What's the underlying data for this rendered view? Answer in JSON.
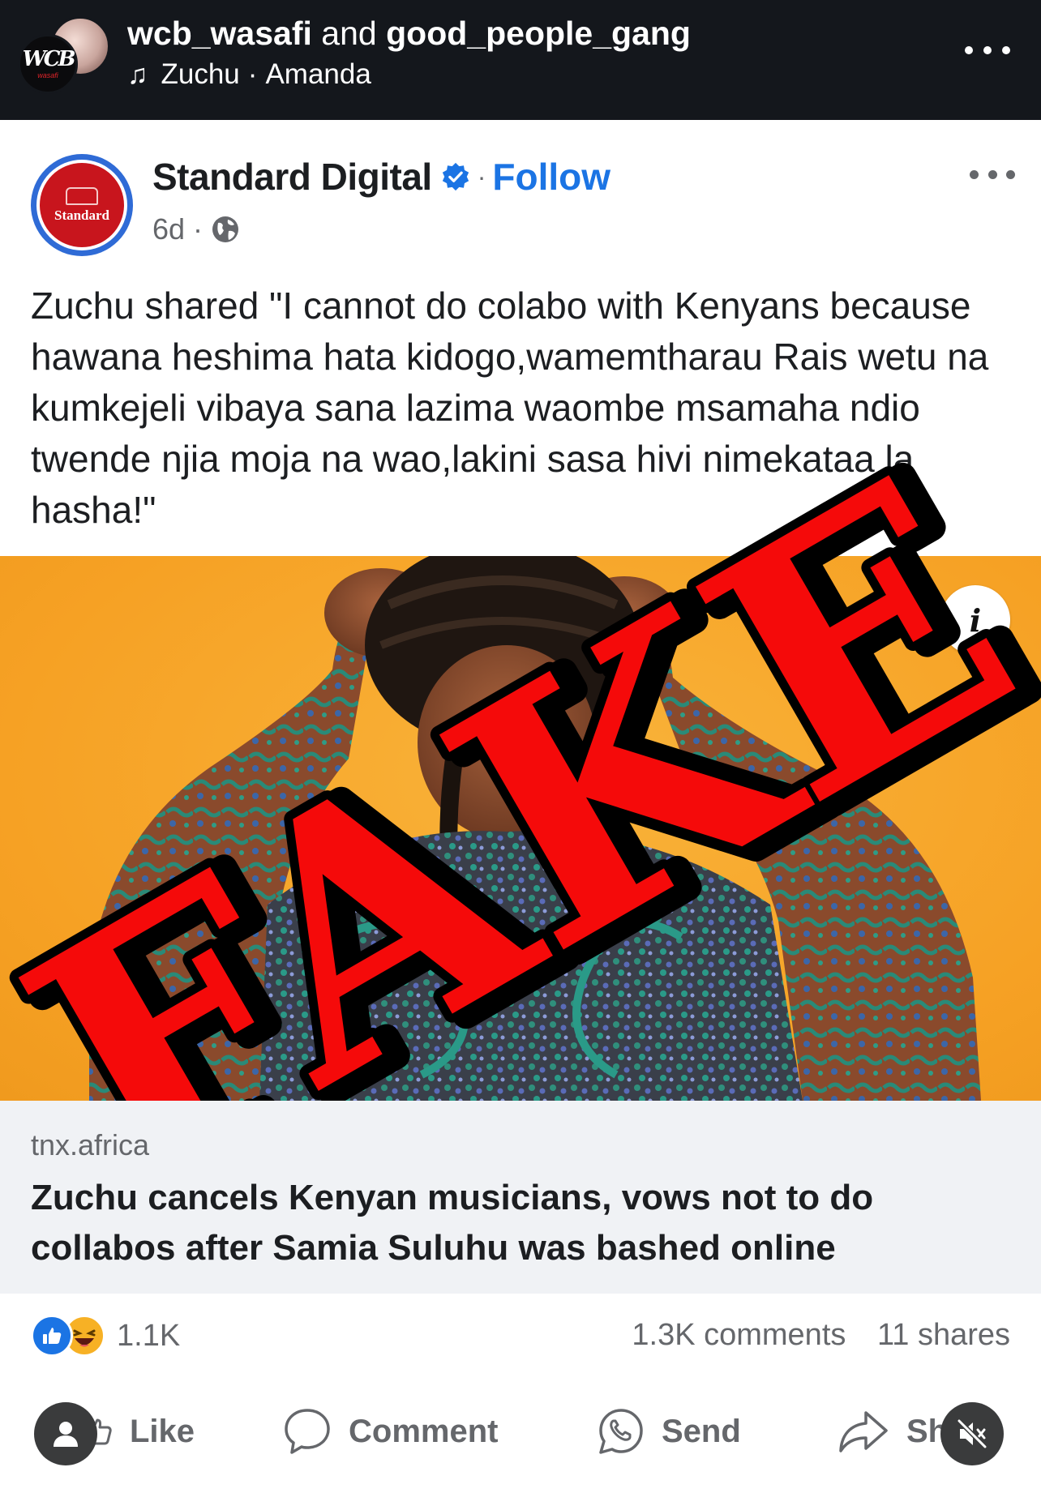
{
  "ig_header": {
    "user1": "wcb_wasafi",
    "conjunction": "and",
    "user2": "good_people_gang",
    "music_artist": "Zuchu",
    "music_separator": "·",
    "music_track": "Amanda",
    "avatar_logo": "WCB",
    "avatar_sub": "wasafi"
  },
  "post": {
    "page_name": "Standard Digital",
    "follow_label": "Follow",
    "separator": "·",
    "age": "6d",
    "avatar_text": "Standard",
    "text": "Zuchu shared \"I cannot do colabo with Kenyans because hawana heshima hata kidogo,wamemtharau Rais wetu na kumkejeli vibaya sana lazima waombe msamaha ndio twende njia moja na wao,lakini sasa hivi nimekataa la hasha!\"",
    "stamp_text": "FAKE",
    "info_label": "i"
  },
  "link_preview": {
    "domain": "tnx.africa",
    "title": "Zuchu cancels Kenyan musicians, vows not to do collabos after Samia Suluhu was bashed online"
  },
  "engagement": {
    "reaction_count": "1.1K",
    "comments": "1.3K comments",
    "shares": "11 shares"
  },
  "actions": {
    "like": "Like",
    "comment": "Comment",
    "send": "Send",
    "share": "Sh"
  },
  "colors": {
    "ig_header_bg": "#14171c",
    "facebook_blue": "#1b74e4",
    "photo_bg": "#f7a52a",
    "stamp_red": "#f50a0a"
  }
}
